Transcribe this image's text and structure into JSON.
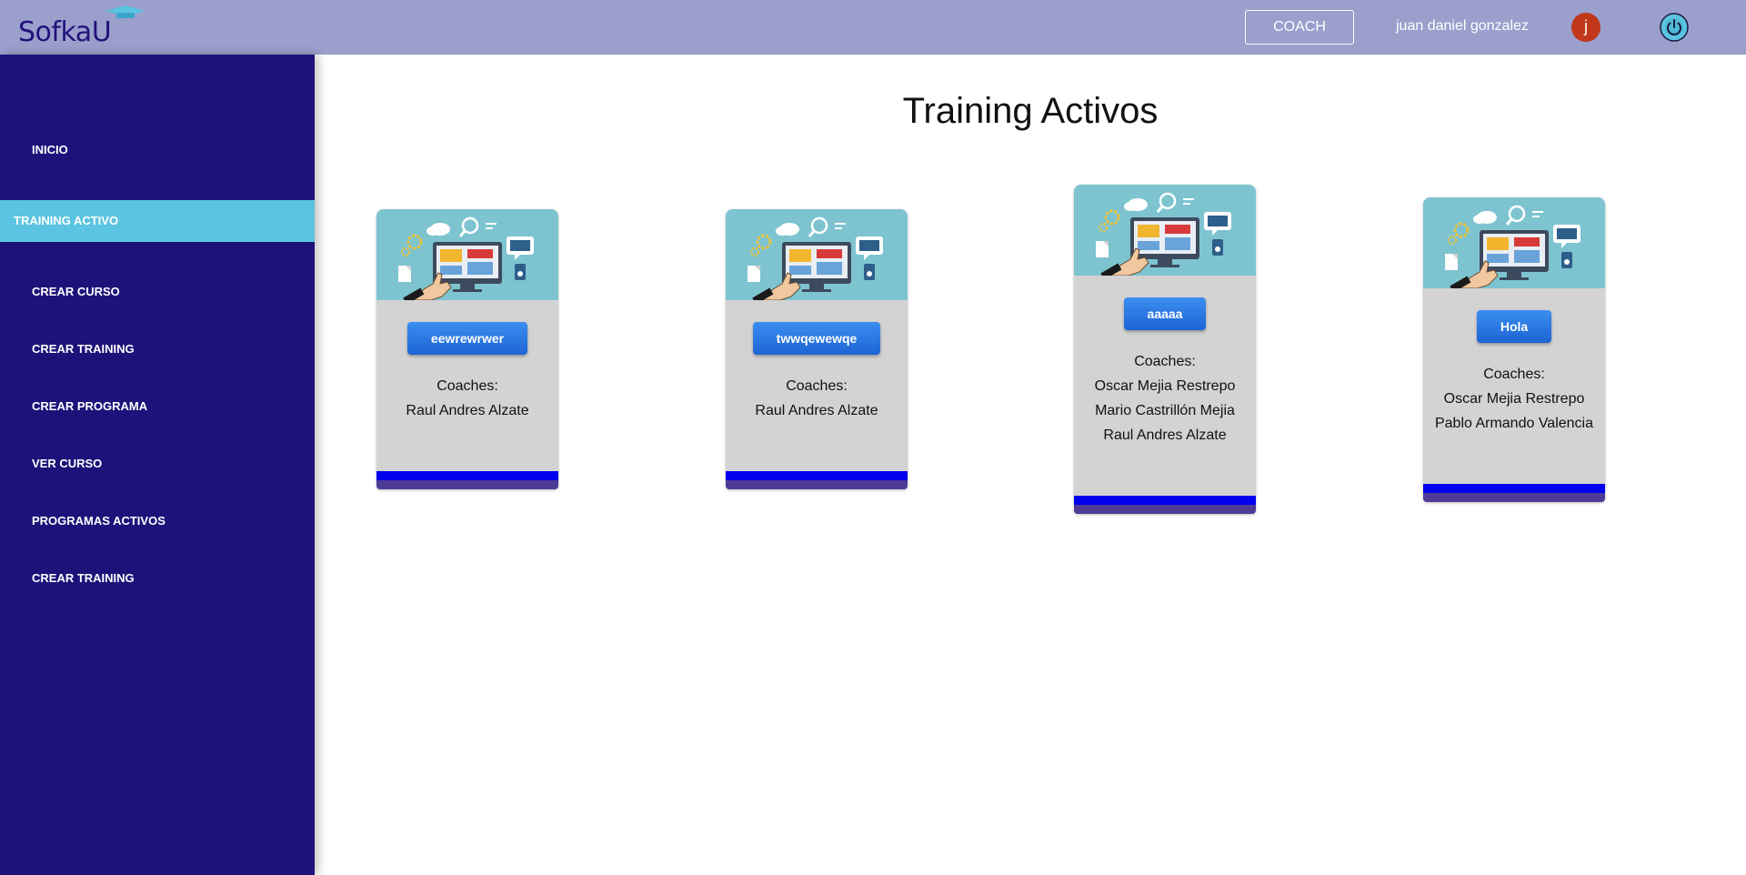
{
  "header": {
    "brand": "SofkaU",
    "role_button": "COACH",
    "user_name": "juan daniel gonzalez",
    "avatar_letter": "j"
  },
  "sidebar": {
    "items": [
      {
        "label": "INICIO",
        "active": false
      },
      {
        "label": "TRAINING ACTIVO",
        "active": true
      },
      {
        "label": "CREAR CURSO",
        "active": false
      },
      {
        "label": "CREAR TRAINING",
        "active": false
      },
      {
        "label": "CREAR PROGRAMA",
        "active": false
      },
      {
        "label": "VER CURSO",
        "active": false
      },
      {
        "label": "PROGRAMAS ACTIVOS",
        "active": false
      },
      {
        "label": "CREAR TRAINING",
        "active": false
      }
    ]
  },
  "main": {
    "title": "Training Activos",
    "cards": [
      {
        "name": "eewrewrwer",
        "coaches_label": "Coaches:",
        "coaches": [
          "Raul Andres Alzate"
        ]
      },
      {
        "name": "twwqewewqe",
        "coaches_label": "Coaches:",
        "coaches": [
          "Raul Andres Alzate"
        ]
      },
      {
        "name": "aaaaa",
        "coaches_label": "Coaches:",
        "coaches": [
          "Oscar Mejia Restrepo",
          "Mario Castrillón Mejia",
          "Raul Andres Alzate"
        ]
      },
      {
        "name": "Hola",
        "coaches_label": "Coaches:",
        "coaches": [
          "Oscar Mejia Restrepo",
          "Pablo Armando Valencia"
        ]
      }
    ]
  },
  "colors": {
    "header_bg": "#9a9fcc",
    "sidebar_bg": "#1e127a",
    "active_item_bg": "#5bc4e0",
    "card_bg": "#d3d3d3",
    "button_blue": "#2a77e6",
    "card_bar_blue": "#0000ee",
    "card_bar_purple": "#4d3b95",
    "avatar_bg": "#c0371a"
  },
  "icons": {
    "logo_cap": "graduation-cap-icon",
    "power": "power-icon",
    "card_illustration": "computer-illustration-icon"
  }
}
